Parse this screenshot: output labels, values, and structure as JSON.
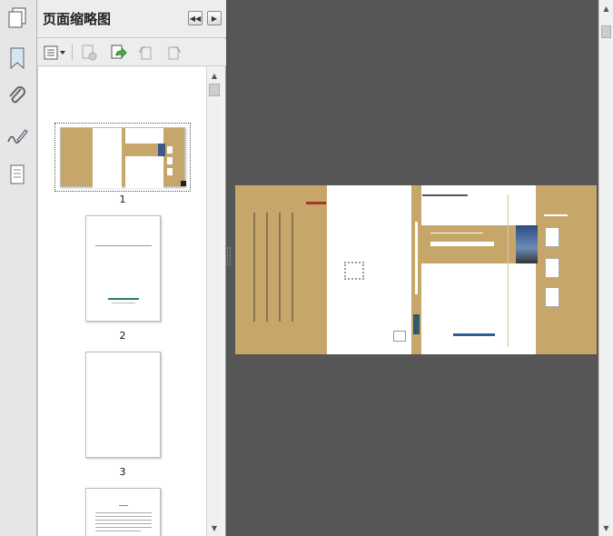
{
  "panel": {
    "title": "页面缩略图"
  },
  "thumbnails": [
    {
      "page": "1",
      "selected": true
    },
    {
      "page": "2",
      "selected": false
    },
    {
      "page": "3",
      "selected": false
    }
  ],
  "rail_icons": [
    "bookmark-icon",
    "attachment-icon",
    "signature-icon",
    "page-content-icon"
  ],
  "toolbar_icons": [
    "options-menu-icon",
    "delete-page-icon",
    "insert-page-icon",
    "rotate-left-icon",
    "rotate-right-icon"
  ],
  "colors": {
    "cover_gold": "#c7a66a",
    "workspace": "#565656"
  }
}
